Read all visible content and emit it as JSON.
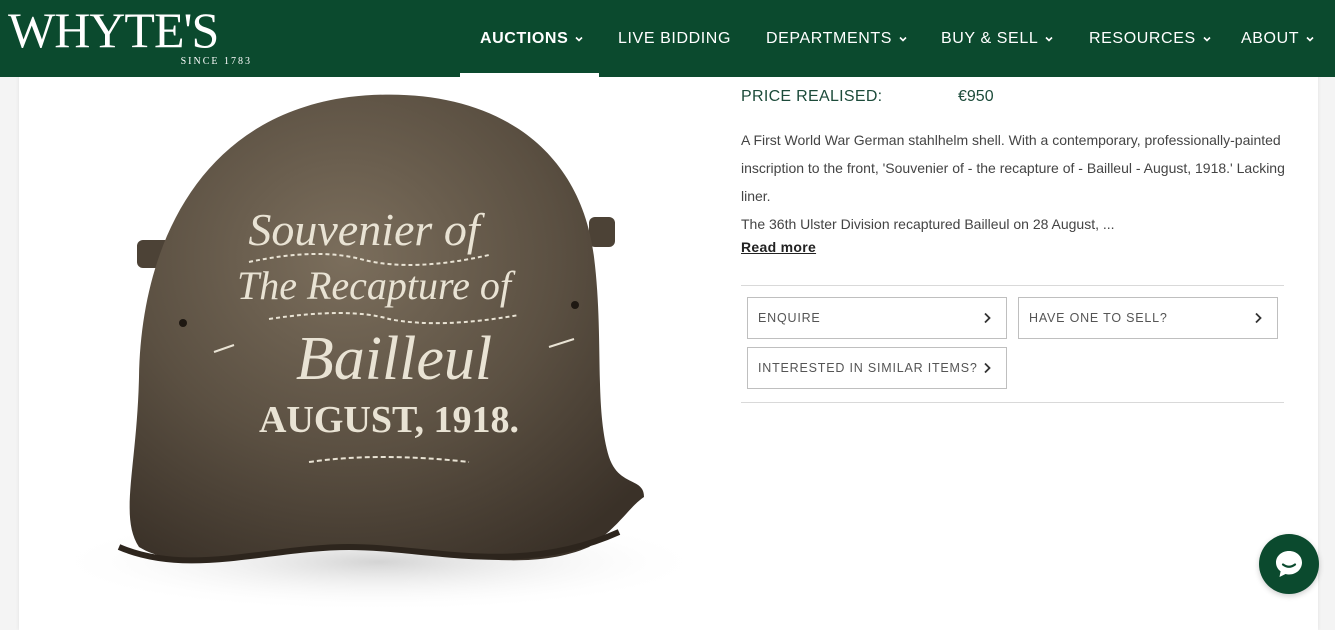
{
  "brand": {
    "logo_text": "WHYTE'S",
    "tagline": "SINCE 1783",
    "header_color": "#0b4a2e"
  },
  "nav": {
    "items": [
      {
        "label": "AUCTIONS",
        "has_dropdown": true,
        "active": true
      },
      {
        "label": "LIVE BIDDING",
        "has_dropdown": false,
        "active": false
      },
      {
        "label": "DEPARTMENTS",
        "has_dropdown": true,
        "active": false
      },
      {
        "label": "BUY & SELL",
        "has_dropdown": true,
        "active": false
      },
      {
        "label": "RESOURCES",
        "has_dropdown": true,
        "active": false
      },
      {
        "label": "ABOUT",
        "has_dropdown": true,
        "active": false
      }
    ],
    "dropdown_icon": "chevron-down-icon"
  },
  "lot": {
    "price_label": "PRICE REALISED:",
    "price_value": "€950",
    "description_lines": [
      "A First World War German stahlhelm shell. With a contemporary, professionally-painted inscription to the front, 'Souvenier of - the recapture of - Bailleul - August, 1918.' Lacking liner.",
      "The 36th Ulster Division recaptured Bailleul on 28 August, ..."
    ],
    "read_more": "Read more",
    "image": {
      "inscription_line1": "Souvenier of",
      "inscription_line2": "The Recapture of",
      "inscription_line3": "Bailleul",
      "inscription_line4": "AUGUST, 1918."
    }
  },
  "actions": {
    "enquire": "ENQUIRE",
    "sell": "HAVE ONE TO SELL?",
    "similar": "INTERESTED IN SIMILAR ITEMS?",
    "arrow_icon": "chevron-right-icon"
  },
  "chat": {
    "icon": "chat-bubble-icon",
    "color": "#0b4a2e"
  }
}
